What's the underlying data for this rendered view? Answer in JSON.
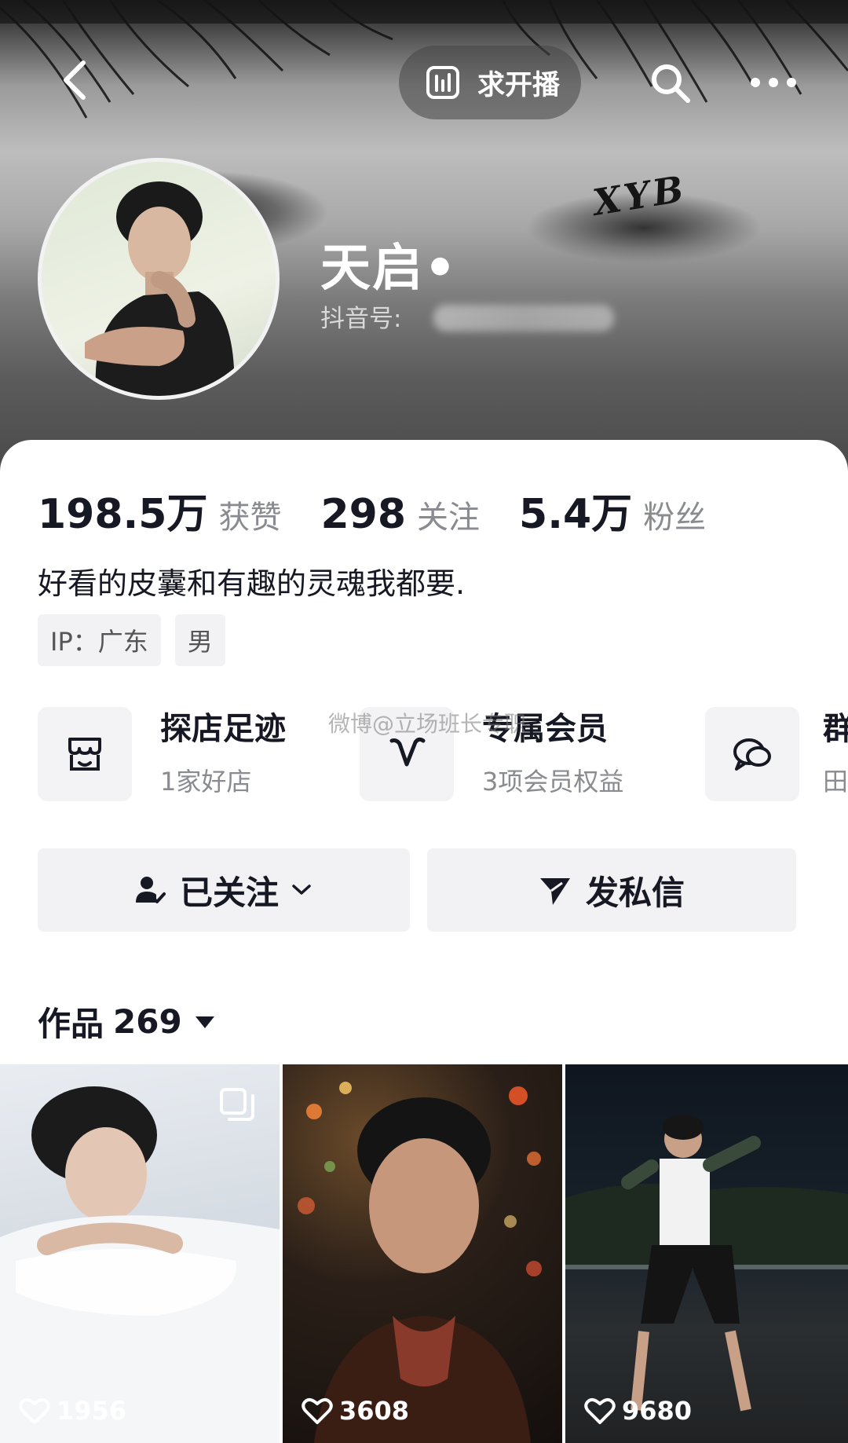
{
  "header": {
    "live_request_label": "求开播",
    "nickname": "天启•",
    "douyin_id_label": "抖音号:",
    "banner_text": "XYB"
  },
  "stats": [
    {
      "value": "198.5万",
      "label": "获赞"
    },
    {
      "value": "298",
      "label": "关注"
    },
    {
      "value": "5.4万",
      "label": "粉丝"
    }
  ],
  "bio": "好看的皮囊和有趣的灵魂我都要.",
  "tags": [
    "IP：广东",
    "男"
  ],
  "services": [
    {
      "title": "探店足迹",
      "subtitle": "1家好店",
      "icon": "shop-icon"
    },
    {
      "title": "专属会员",
      "subtitle": "3项会员权益",
      "icon": "vip-icon"
    },
    {
      "title": "群",
      "subtitle": "田",
      "icon": "group-chat-icon"
    }
  ],
  "watermark": "微博@立场班长专职",
  "actions": {
    "follow_label": "已关注",
    "message_label": "发私信"
  },
  "works": {
    "label": "作品",
    "count": "269",
    "items": [
      {
        "likes": "1956",
        "multi_image": true
      },
      {
        "likes": "3608",
        "multi_image": false
      },
      {
        "likes": "9680",
        "multi_image": false
      }
    ]
  },
  "colors": {
    "primary_text": "#161823",
    "secondary_text": "#8a8b91",
    "button_bg": "#f2f2f4"
  }
}
